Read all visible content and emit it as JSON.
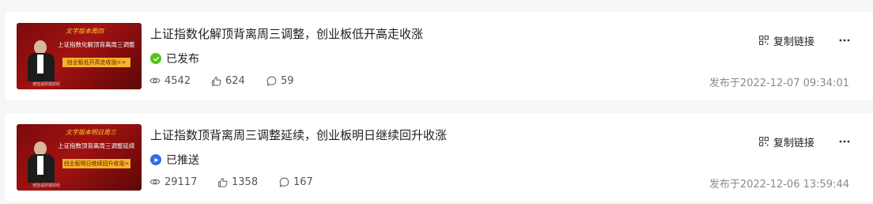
{
  "articles": [
    {
      "title": "上证指数化解顶背离周三调整，创业板低开高走收涨",
      "status": "已发布",
      "status_icon": "check-circle-icon",
      "status_color": "#52c41a",
      "views": "4542",
      "likes": "624",
      "comments": "59",
      "published": "发布于2022-12-07 09:34:01",
      "copy_label": "复制链接",
      "thumbnail": {
        "top_text": "文字版本周四",
        "main_text": "上证指数化解顶背离周三调整",
        "tag_text": "创业板低开高走收涨>>",
        "foot_text": "老陆说研报财经"
      }
    },
    {
      "title": "上证指数顶背离周三调整延续，创业板明日继续回升收涨",
      "status": "已推送",
      "status_icon": "send-circle-icon",
      "status_color": "#2b6fe6",
      "views": "29117",
      "likes": "1358",
      "comments": "167",
      "published": "发布于2022-12-06 13:59:44",
      "copy_label": "复制链接",
      "thumbnail": {
        "top_text": "文字版本明日周三",
        "main_text": "上证指数顶背离周三调整延续",
        "tag_text": "创业板明日继续回升收涨>",
        "foot_text": "老陆说研报财经"
      }
    }
  ]
}
